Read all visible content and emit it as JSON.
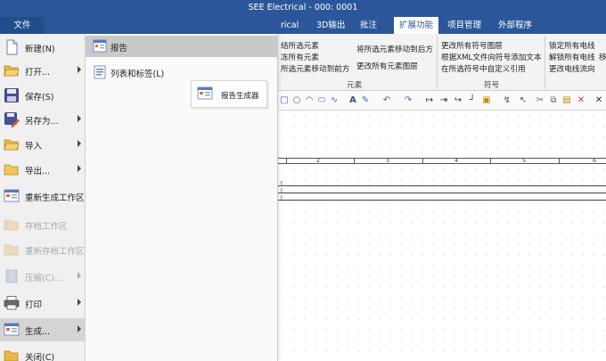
{
  "app": {
    "title": "SEE Electrical - 000: 0001"
  },
  "tabs": [
    {
      "label": "文件"
    },
    {
      "label": "rical"
    },
    {
      "label": "3D输出"
    },
    {
      "label": "批注"
    },
    {
      "label": "扩展功能",
      "active": true
    },
    {
      "label": "项目管理"
    },
    {
      "label": "外部程序"
    }
  ],
  "ribbon": {
    "elements": {
      "cmd1": "结所选元素",
      "cmd2": "冻所有元素",
      "cmd3": "所选元素移动到前方",
      "cmd4": "将所选元素移动到后方",
      "cmd5": "更改所有元素图层",
      "group": "元素"
    },
    "symbols": {
      "cmd1": "更改所有符号图层",
      "cmd2": "根据XML文件向符号添加文本",
      "cmd3": "在所选符号中自定义引用",
      "group": "符号"
    },
    "wires": {
      "cmd1": "锁定所有电线",
      "cmd2": "解锁所有电线",
      "cmd2_tail": "移",
      "cmd3": "更改电线流向"
    }
  },
  "ruler": {
    "numbers": [
      "2",
      "3",
      "4",
      "5",
      "6"
    ]
  },
  "sheet_marks": [
    "?",
    "?",
    "?"
  ],
  "file_menu": {
    "items": [
      {
        "label": "新建(N)",
        "icon": "new-doc-icon",
        "arrow": false,
        "disabled": false
      },
      {
        "label": "打开...",
        "icon": "open-folder-icon",
        "arrow": true,
        "disabled": false
      },
      {
        "label": "保存(S)",
        "icon": "save-icon",
        "arrow": false,
        "disabled": false
      },
      {
        "label": "另存为...",
        "icon": "save-as-icon",
        "arrow": true,
        "disabled": false
      },
      {
        "label": "导入",
        "icon": "import-folder-icon",
        "arrow": true,
        "disabled": false
      },
      {
        "label": "导出...",
        "icon": "export-folder-icon",
        "arrow": true,
        "disabled": false
      },
      {
        "label": "重新生成工作区",
        "icon": "regenerate-workspace-icon",
        "arrow": false,
        "disabled": false
      },
      {
        "label": "存档工作区",
        "icon": "archive-workspace-icon",
        "arrow": false,
        "disabled": true
      },
      {
        "label": "重新存档工作区",
        "icon": "rearchive-workspace-icon",
        "arrow": false,
        "disabled": true
      },
      {
        "label": "压缩(C)...",
        "icon": "compress-icon",
        "arrow": true,
        "disabled": true
      },
      {
        "label": "打印",
        "icon": "print-icon",
        "arrow": true,
        "disabled": false
      },
      {
        "label": "生成...",
        "icon": "generate-icon",
        "arrow": true,
        "disabled": false,
        "selected": true
      },
      {
        "label": "关闭(C)",
        "icon": "close-folder-icon",
        "arrow": false,
        "disabled": false
      }
    ],
    "submenu": [
      {
        "label": "报告",
        "icon": "report-icon",
        "selected": true
      },
      {
        "label": "列表和标签(L)",
        "icon": "list-labels-icon",
        "selected": false
      }
    ],
    "popup": {
      "label": "报告生成器",
      "icon": "report-generator-icon"
    }
  },
  "colors": {
    "accent": "#2b579a",
    "ribbon_bg": "#f3f3f3",
    "menu_bg": "#f0f0f0"
  }
}
